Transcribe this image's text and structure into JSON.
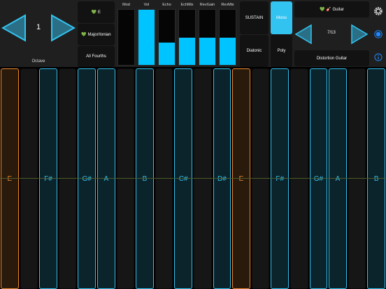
{
  "octave": {
    "value": "1",
    "label": "Octave"
  },
  "scale": {
    "key_label": "💚 E",
    "mode_label": "💚 Major/Ionian",
    "layout_label": "All Fourths"
  },
  "sliders": [
    {
      "label": "Mod",
      "value": 0.0
    },
    {
      "label": "Vol",
      "value": 1.0
    },
    {
      "label": "Echo",
      "value": 0.4
    },
    {
      "label": "EchMix",
      "value": 0.5
    },
    {
      "label": "RevGain",
      "value": 0.5
    },
    {
      "label": "RevMix",
      "value": 0.5
    }
  ],
  "modes": {
    "sustain": "SUSTAIN",
    "mono": "Mono",
    "diatonic": "Diatonic",
    "poly": "Poly"
  },
  "instrument": {
    "header": "💚 🎸 Guitar",
    "counter": "7/13",
    "name": "Distortion Guitar"
  },
  "keys": [
    {
      "label": "E",
      "color": "orange"
    },
    {
      "label": "",
      "color": "off"
    },
    {
      "label": "F#",
      "color": "blue"
    },
    {
      "label": "",
      "color": "off"
    },
    {
      "label": "G#",
      "color": "blue"
    },
    {
      "label": "A",
      "color": "blue"
    },
    {
      "label": "",
      "color": "off"
    },
    {
      "label": "B",
      "color": "blue"
    },
    {
      "label": "",
      "color": "off"
    },
    {
      "label": "C#",
      "color": "blue"
    },
    {
      "label": "",
      "color": "off"
    },
    {
      "label": "D#",
      "color": "blue"
    },
    {
      "label": "E",
      "color": "orange"
    },
    {
      "label": "",
      "color": "off"
    },
    {
      "label": "F#",
      "color": "blue"
    },
    {
      "label": "",
      "color": "off"
    },
    {
      "label": "G#",
      "color": "blue"
    },
    {
      "label": "A",
      "color": "blue"
    },
    {
      "label": "",
      "color": "off"
    },
    {
      "label": "B",
      "color": "blue"
    }
  ],
  "colors": {
    "accent": "#00c4ff",
    "root": "#f08a30",
    "scale": "#33c3f0"
  }
}
